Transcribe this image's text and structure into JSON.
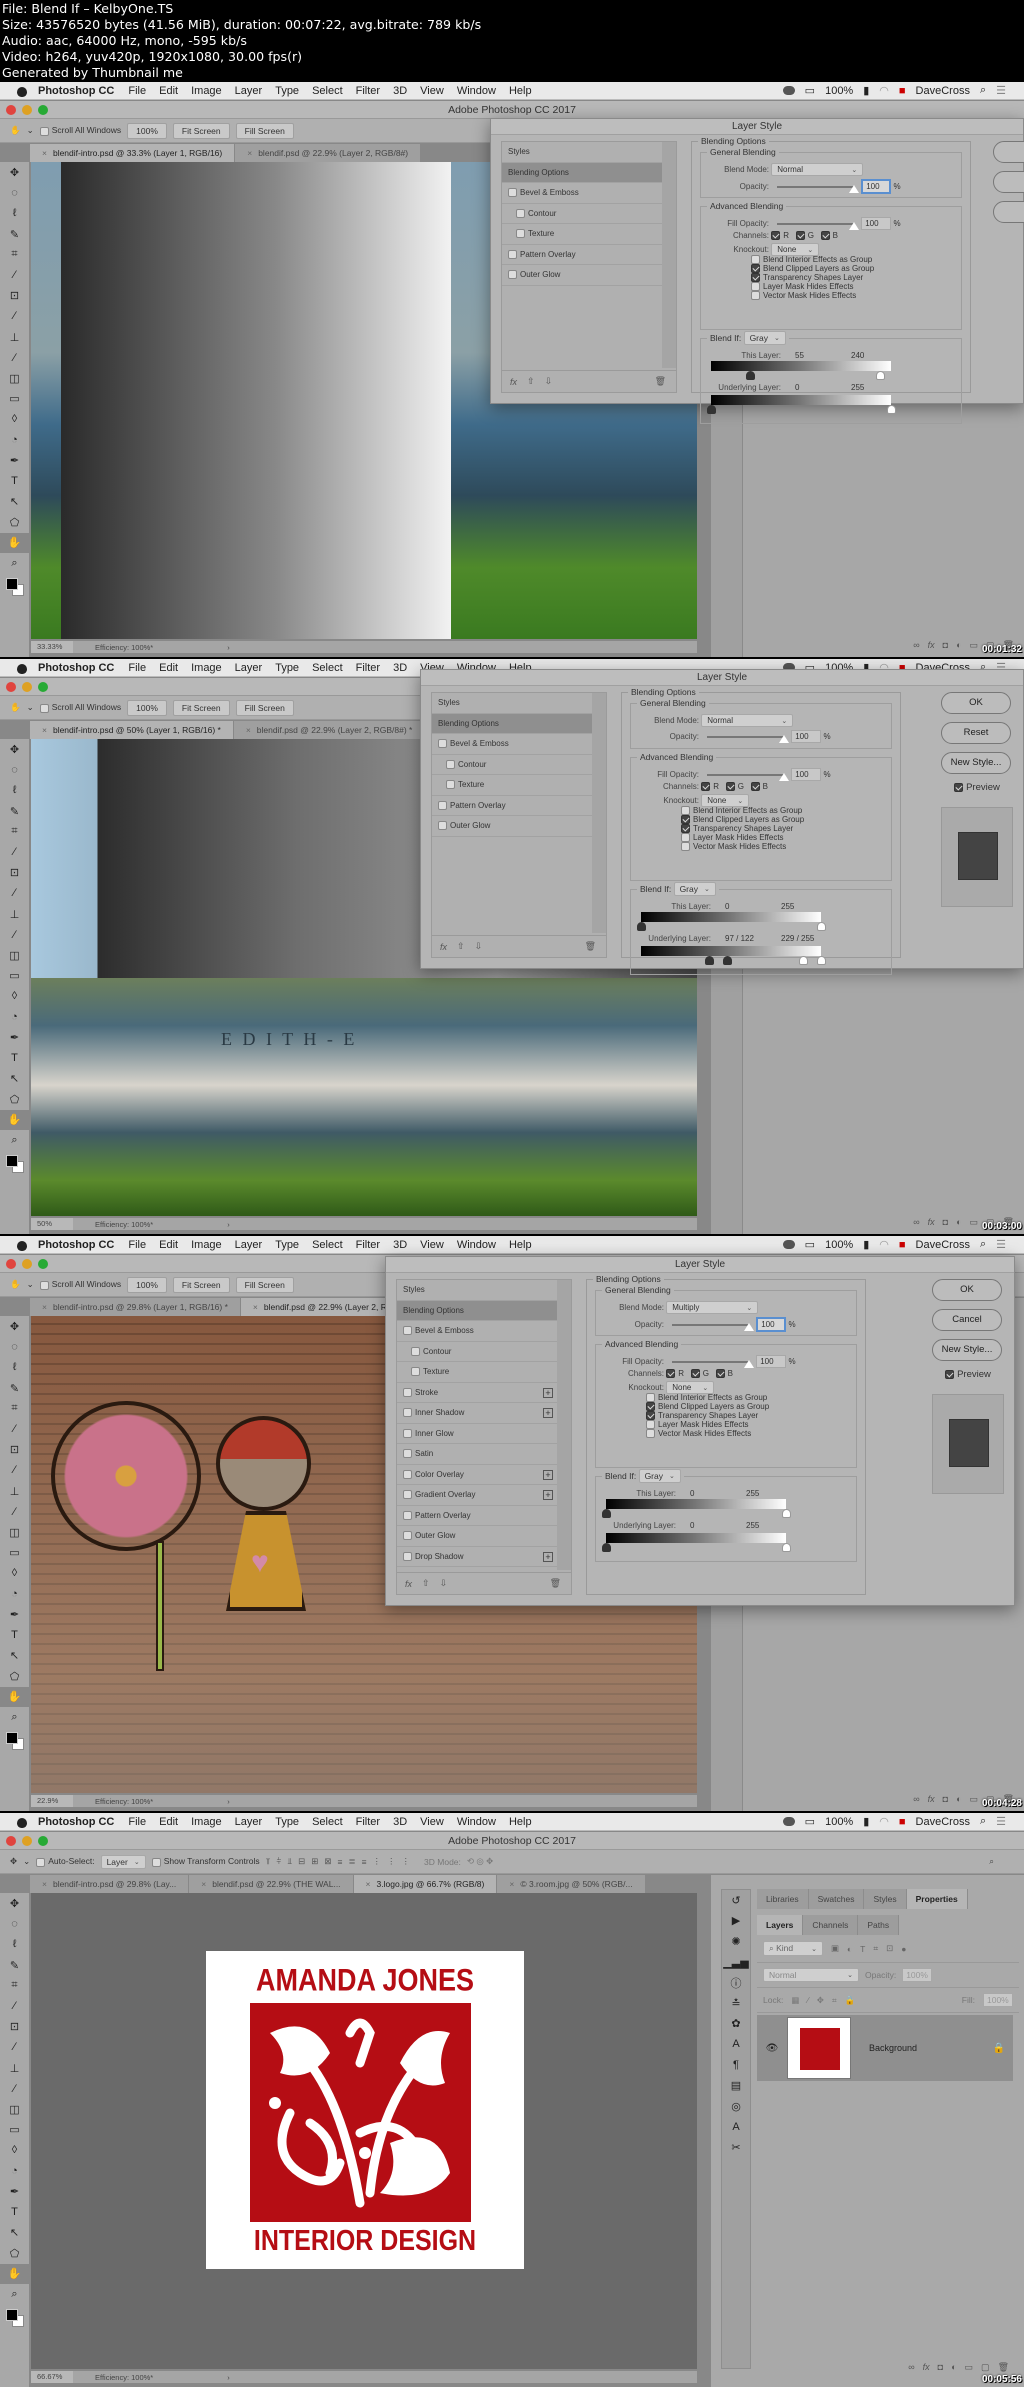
{
  "header": {
    "lines": [
      "File: Blend If – KelbyOne.TS",
      "Size: 43576520 bytes (41.56 MiB), duration: 00:07:22, avg.bitrate: 789 kb/s",
      "Audio: aac, 64000 Hz, mono, -595 kb/s",
      "Video: h264, yuv420p, 1920x1080, 30.00 fps(r)",
      "Generated by Thumbnail me"
    ]
  },
  "menubar": {
    "app": "Photoshop CC",
    "items": [
      "File",
      "Edit",
      "Image",
      "Layer",
      "Type",
      "Select",
      "Filter",
      "3D",
      "View",
      "Window",
      "Help"
    ],
    "battery": "100%",
    "user": "DaveCross"
  },
  "window_title": "Adobe Photoshop CC 2017",
  "hand_options": {
    "scroll_all": "Scroll All Windows",
    "btn_100": "100%",
    "fit": "Fit Screen",
    "fill": "Fill Screen"
  },
  "frames": [
    {
      "timestamp": "00:01:32",
      "tabs": [
        "blendif-intro.psd @ 33.3% (Layer 1, RGB/16)",
        "blendif.psd @ 22.9% (Layer 2, RGB/8#)"
      ],
      "zoom": "33.33%",
      "efficiency": "Efficiency: 100%*",
      "dialog": {
        "title": "Layer Style",
        "styles_header": "Styles",
        "items": [
          "Blending Options",
          "Bevel & Emboss",
          "Contour",
          "Texture",
          "Pattern Overlay",
          "Outer Glow"
        ],
        "blend_mode": "Normal",
        "opacity": "100",
        "fill_opacity": "100",
        "knockout": "None",
        "blend_if": "Gray",
        "this_layer": [
          "55",
          "240"
        ],
        "underlying": [
          "0",
          "255"
        ]
      }
    },
    {
      "timestamp": "00:03:00",
      "tabs": [
        "blendif-intro.psd @ 50% (Layer 1, RGB/16) *",
        "blendif.psd @ 22.9% (Layer 2, RGB/8#) *"
      ],
      "zoom": "50%",
      "efficiency": "Efficiency: 100%*",
      "dialog": {
        "title": "Layer Style",
        "styles_header": "Styles",
        "items": [
          "Blending Options",
          "Bevel & Emboss",
          "Contour",
          "Texture",
          "Pattern Overlay",
          "Outer Glow"
        ],
        "blend_mode": "Normal",
        "opacity": "100",
        "fill_opacity": "100",
        "knockout": "None",
        "blend_if": "Gray",
        "this_layer": [
          "0",
          "255"
        ],
        "underlying": [
          "97 / 122",
          "229 / 255"
        ],
        "buttons": [
          "OK",
          "Reset",
          "New Style..."
        ],
        "preview": "Preview"
      }
    },
    {
      "timestamp": "00:04:28",
      "tabs": [
        "blendif-intro.psd @ 29.8% (Layer 1, RGB/16) *",
        "blendif.psd @ 22.9% (Layer 2, RGB/8#) *"
      ],
      "zoom": "22.9%",
      "efficiency": "Efficiency: 100%*",
      "dialog": {
        "title": "Layer Style",
        "styles_header": "Styles",
        "items": [
          "Blending Options",
          "Bevel & Emboss",
          "Contour",
          "Texture",
          "Stroke",
          "Inner Shadow",
          "Inner Glow",
          "Satin",
          "Color Overlay",
          "Gradient Overlay",
          "Pattern Overlay",
          "Outer Glow",
          "Drop Shadow"
        ],
        "blend_mode": "Multiply",
        "opacity": "100",
        "fill_opacity": "100",
        "knockout": "None",
        "blend_if": "Gray",
        "this_layer": [
          "0",
          "255"
        ],
        "underlying": [
          "0",
          "255"
        ],
        "buttons": [
          "OK",
          "Cancel",
          "New Style..."
        ],
        "preview": "Preview"
      }
    },
    {
      "timestamp": "00:05:56",
      "tabs": [
        "blendif-intro.psd @ 29.8% (Lay...",
        "blendif.psd @ 22.9% (THE WAL...",
        "3.logo.jpg @ 66.7% (RGB/8)",
        "© 3.room.jpg @ 50% (RGB/..."
      ],
      "zoom": "66.67%",
      "efficiency": "Efficiency: 100%*",
      "move_options": {
        "auto_select": "Auto-Select:",
        "layer": "Layer",
        "show_transform": "Show Transform Controls",
        "mode_3d": "3D Mode:"
      },
      "panel_tabs": [
        "Libraries",
        "Swatches",
        "Styles",
        "Properties"
      ],
      "layer_tabs": [
        "Layers",
        "Channels",
        "Paths"
      ],
      "kind": "Kind",
      "blend_mode": "Normal",
      "opacity_label": "Opacity:",
      "opacity": "100%",
      "lock_label": "Lock:",
      "fill_label": "Fill:",
      "fill": "100%",
      "layer_name": "Background",
      "logo": {
        "top": "AMANDA JONES",
        "bottom": "INTERIOR DESIGN",
        "color": "#b50d14"
      }
    }
  ],
  "labels": {
    "blending_options": "Blending Options",
    "general_blending": "General Blending",
    "blend_mode": "Blend Mode:",
    "opacity": "Opacity:",
    "advanced_blending": "Advanced Blending",
    "fill_opacity": "Fill Opacity:",
    "channels": "Channels:",
    "r": "R",
    "g": "G",
    "b": "B",
    "knockout": "Knockout:",
    "adv_checks": [
      "Blend Interior Effects as Group",
      "Blend Clipped Layers as Group",
      "Transparency Shapes Layer",
      "Layer Mask Hides Effects",
      "Vector Mask Hides Effects"
    ],
    "adv_checks_on": [
      false,
      true,
      true,
      false,
      false
    ],
    "blend_if": "Blend If:",
    "this_layer": "This Layer:",
    "underlying": "Underlying Layer:",
    "pct": "%"
  },
  "blend_if_fractions": [
    {
      "this": [
        0.216,
        0.941
      ],
      "under": [
        0,
        1
      ]
    },
    {
      "this": [
        0,
        1
      ],
      "under": [
        0.38,
        0.478,
        0.898,
        1
      ]
    },
    {
      "this": [
        0,
        1
      ],
      "under": [
        0,
        1
      ]
    }
  ]
}
